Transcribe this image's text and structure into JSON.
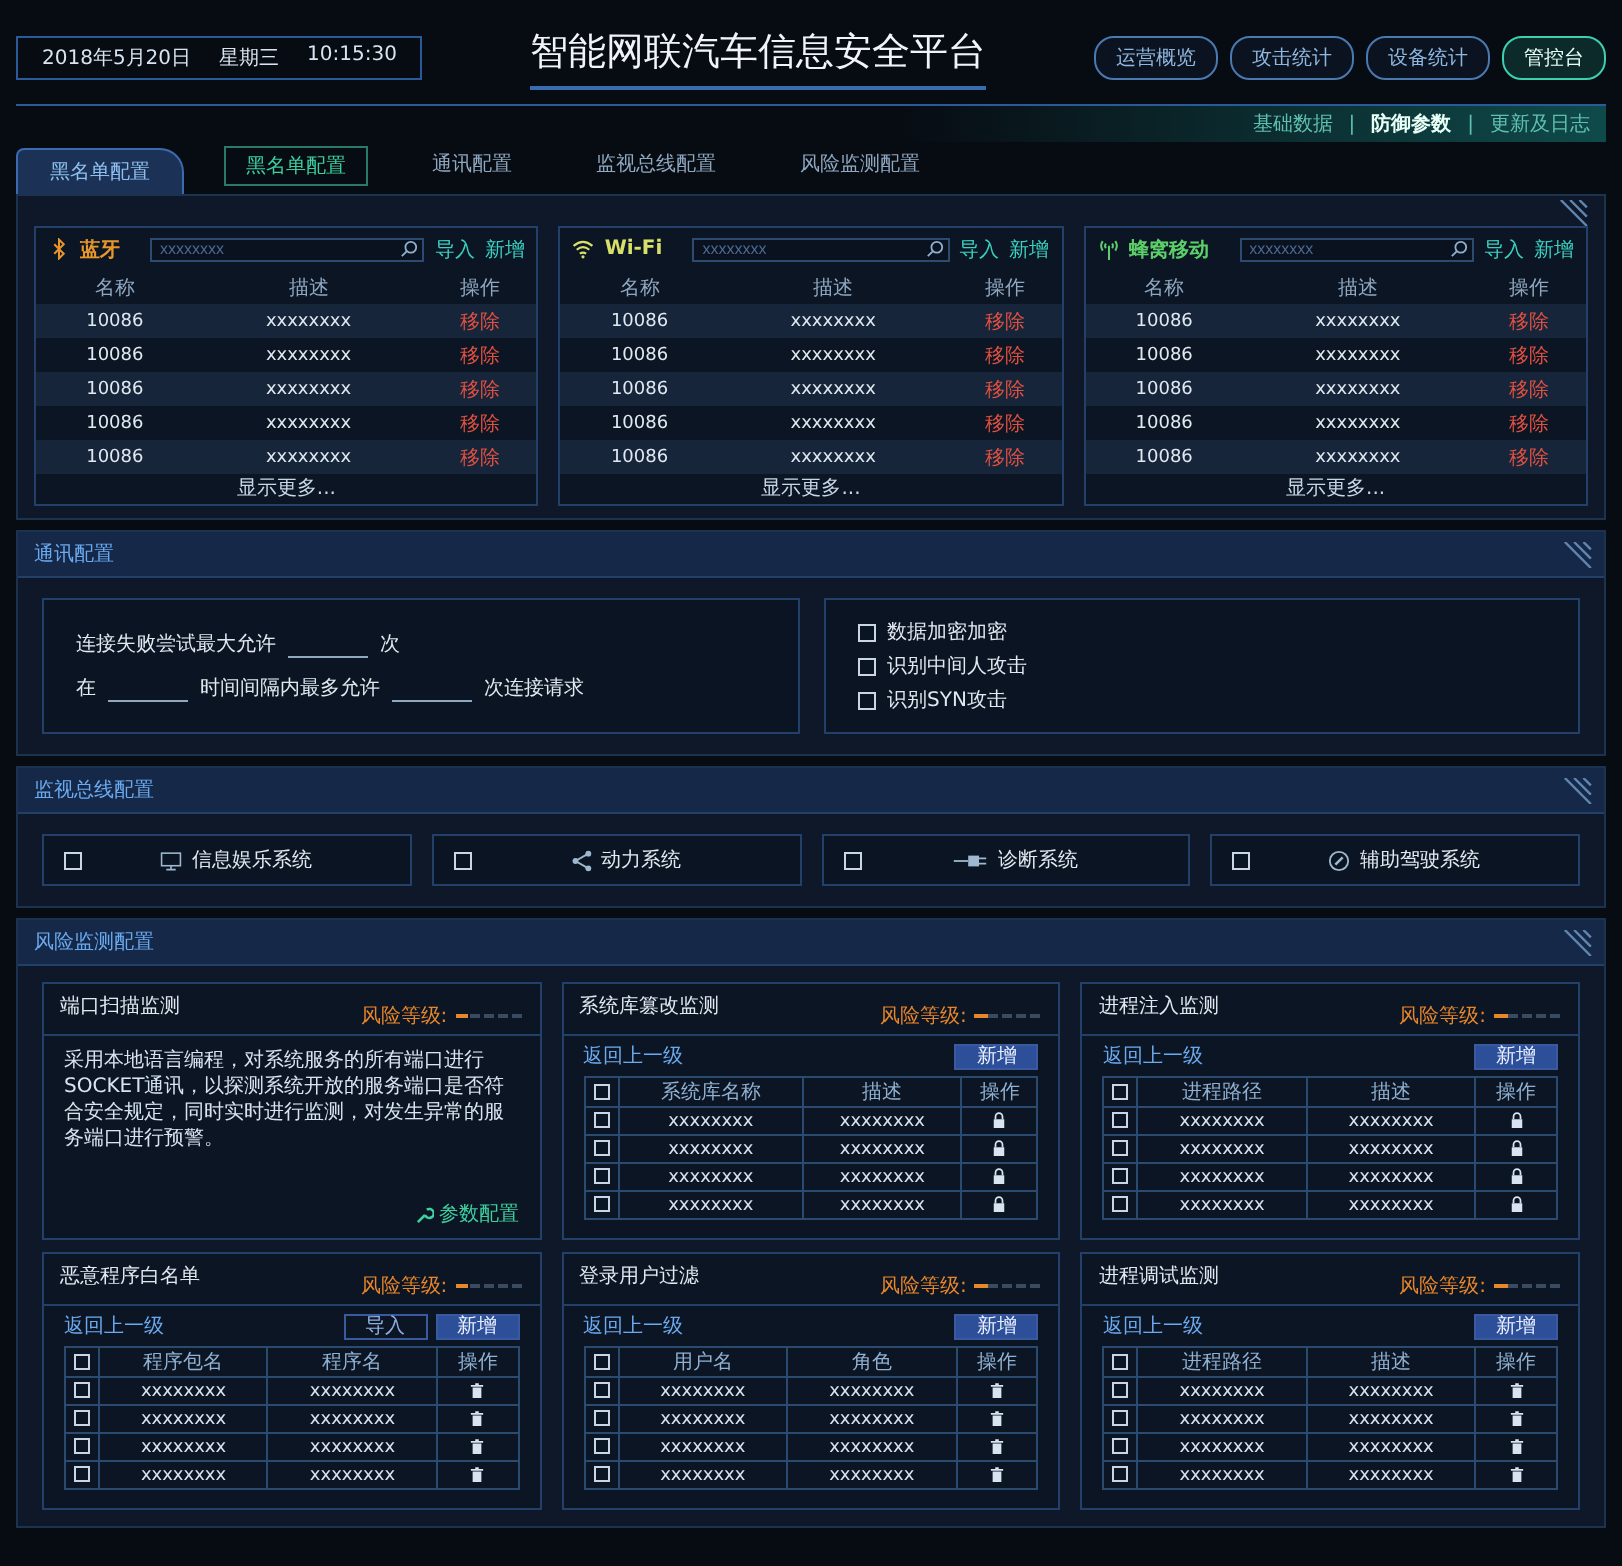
{
  "header": {
    "date": "2018年5月20日",
    "weekday": "星期三",
    "time": "10:15:30",
    "title": "智能网联汽车信息安全平台"
  },
  "nav": [
    {
      "label": "运营概览",
      "selected": false
    },
    {
      "label": "攻击统计",
      "selected": false
    },
    {
      "label": "设备统计",
      "selected": false
    },
    {
      "label": "管控台",
      "selected": true
    }
  ],
  "subnav": [
    {
      "kind": "link",
      "label": "基础数据",
      "selected": false
    },
    {
      "kind": "separator",
      "label": "|"
    },
    {
      "kind": "link",
      "label": "防御参数",
      "selected": true
    },
    {
      "kind": "separator",
      "label": "|"
    },
    {
      "kind": "link",
      "label": "更新及日志",
      "selected": false
    }
  ],
  "side_tab": {
    "label": "黑名单配置"
  },
  "tabs": [
    {
      "label": "黑名单配置",
      "selected": true
    },
    {
      "label": "通讯配置",
      "selected": false
    },
    {
      "label": "监视总线配置",
      "selected": false
    },
    {
      "label": "风险监测配置",
      "selected": false
    }
  ],
  "blacklist": {
    "lists": [
      {
        "kind": "bluetooth",
        "title": "蓝牙",
        "placeholder": "xxxxxxxx",
        "actions": [
          "导入",
          "新增"
        ],
        "columns": [
          "名称",
          "描述",
          "操作"
        ],
        "rows": [
          [
            "10086",
            "xxxxxxxx",
            "移除"
          ],
          [
            "10086",
            "xxxxxxxx",
            "移除"
          ],
          [
            "10086",
            "xxxxxxxx",
            "移除"
          ],
          [
            "10086",
            "xxxxxxxx",
            "移除"
          ],
          [
            "10086",
            "xxxxxxxx",
            "移除"
          ]
        ],
        "more": "显示更多..."
      },
      {
        "kind": "wifi",
        "title": "Wi-Fi",
        "placeholder": "xxxxxxxx",
        "actions": [
          "导入",
          "新增"
        ],
        "columns": [
          "名称",
          "描述",
          "操作"
        ],
        "rows": [
          [
            "10086",
            "xxxxxxxx",
            "移除"
          ],
          [
            "10086",
            "xxxxxxxx",
            "移除"
          ],
          [
            "10086",
            "xxxxxxxx",
            "移除"
          ],
          [
            "10086",
            "xxxxxxxx",
            "移除"
          ],
          [
            "10086",
            "xxxxxxxx",
            "移除"
          ]
        ],
        "more": "显示更多..."
      },
      {
        "kind": "cellular",
        "title": "蜂窝移动",
        "placeholder": "xxxxxxxx",
        "actions": [
          "导入",
          "新增"
        ],
        "columns": [
          "名称",
          "描述",
          "操作"
        ],
        "rows": [
          [
            "10086",
            "xxxxxxxx",
            "移除"
          ],
          [
            "10086",
            "xxxxxxxx",
            "移除"
          ],
          [
            "10086",
            "xxxxxxxx",
            "移除"
          ],
          [
            "10086",
            "xxxxxxxx",
            "移除"
          ],
          [
            "10086",
            "xxxxxxxx",
            "移除"
          ]
        ],
        "more": "显示更多..."
      }
    ]
  },
  "comm": {
    "title": "通讯配置",
    "lines": [
      [
        {
          "kind": "text",
          "text": "连接失败尝试最大允许"
        },
        {
          "kind": "field"
        },
        {
          "kind": "text",
          "text": "次"
        }
      ],
      [
        {
          "kind": "text",
          "text": "在"
        },
        {
          "kind": "field"
        },
        {
          "kind": "text",
          "text": "时间间隔内最多允许"
        },
        {
          "kind": "field"
        },
        {
          "kind": "text",
          "text": "次连接请求"
        }
      ]
    ],
    "options": [
      {
        "label": "数据加密加密",
        "checked": false
      },
      {
        "label": "识别中间人攻击",
        "checked": false
      },
      {
        "label": "识别SYN攻击",
        "checked": false
      }
    ]
  },
  "bus": {
    "title": "监视总线配置",
    "systems": [
      {
        "kind": "display",
        "label": "信息娱乐系统",
        "checked": false
      },
      {
        "kind": "share",
        "label": "动力系统",
        "checked": false
      },
      {
        "kind": "plug",
        "label": "诊断系统",
        "checked": false
      },
      {
        "kind": "gauge",
        "label": "辅助驾驶系统",
        "checked": false
      }
    ]
  },
  "risk": {
    "title": "风险监测配置",
    "cards": [
      {
        "kind": "text",
        "title": "端口扫描监测",
        "risk_label": "风险等级:",
        "level": 0.2,
        "body": "采用本地语言编程，对系统服务的所有端口进行SOCKET通讯，以探测系统开放的服务端口是否符合安全规定，同时实时进行监测，对发生异常的服务端口进行预警。",
        "link": "参数配置"
      },
      {
        "kind": "table",
        "title": "系统库篡改监测",
        "risk_label": "风险等级:",
        "level": 0.2,
        "back": "返回上一级",
        "buttons": [
          {
            "kind": "primary",
            "label": "新增"
          }
        ],
        "columns": [
          "系统库名称",
          "描述",
          "操作"
        ],
        "select_all": {
          "checked": false
        },
        "rows": [
          {
            "kind": "lock",
            "cells": [
              "xxxxxxxx",
              "xxxxxxxx"
            ],
            "checked": false
          },
          {
            "kind": "lock",
            "cells": [
              "xxxxxxxx",
              "xxxxxxxx"
            ],
            "checked": false
          },
          {
            "kind": "lock",
            "cells": [
              "xxxxxxxx",
              "xxxxxxxx"
            ],
            "checked": false
          },
          {
            "kind": "lock",
            "cells": [
              "xxxxxxxx",
              "xxxxxxxx"
            ],
            "checked": false
          }
        ]
      },
      {
        "kind": "table",
        "title": "进程注入监测",
        "risk_label": "风险等级:",
        "level": 0.2,
        "back": "返回上一级",
        "buttons": [
          {
            "kind": "primary",
            "label": "新增"
          }
        ],
        "columns": [
          "进程路径",
          "描述",
          "操作"
        ],
        "select_all": {
          "checked": false
        },
        "rows": [
          {
            "kind": "lock",
            "cells": [
              "xxxxxxxx",
              "xxxxxxxx"
            ],
            "checked": false
          },
          {
            "kind": "lock",
            "cells": [
              "xxxxxxxx",
              "xxxxxxxx"
            ],
            "checked": false
          },
          {
            "kind": "lock",
            "cells": [
              "xxxxxxxx",
              "xxxxxxxx"
            ],
            "checked": false
          },
          {
            "kind": "lock",
            "cells": [
              "xxxxxxxx",
              "xxxxxxxx"
            ],
            "checked": false
          }
        ]
      },
      {
        "kind": "table",
        "title": "恶意程序白名单",
        "risk_label": "风险等级:",
        "level": 0.2,
        "back": "返回上一级",
        "buttons": [
          {
            "kind": "outline",
            "label": "导入"
          },
          {
            "kind": "primary",
            "label": "新增"
          }
        ],
        "columns": [
          "程序包名",
          "程序名",
          "操作"
        ],
        "select_all": {
          "checked": false
        },
        "rows": [
          {
            "kind": "trash",
            "cells": [
              "xxxxxxxx",
              "xxxxxxxx"
            ],
            "checked": false
          },
          {
            "kind": "trash",
            "cells": [
              "xxxxxxxx",
              "xxxxxxxx"
            ],
            "checked": false
          },
          {
            "kind": "trash",
            "cells": [
              "xxxxxxxx",
              "xxxxxxxx"
            ],
            "checked": false
          },
          {
            "kind": "trash",
            "cells": [
              "xxxxxxxx",
              "xxxxxxxx"
            ],
            "checked": false
          }
        ]
      },
      {
        "kind": "table",
        "title": "登录用户过滤",
        "risk_label": "风险等级:",
        "level": 0.2,
        "back": "返回上一级",
        "buttons": [
          {
            "kind": "primary",
            "label": "新增"
          }
        ],
        "columns": [
          "用户名",
          "角色",
          "操作"
        ],
        "select_all": {
          "checked": false
        },
        "rows": [
          {
            "kind": "trash",
            "cells": [
              "xxxxxxxx",
              "xxxxxxxx"
            ],
            "checked": false
          },
          {
            "kind": "trash",
            "cells": [
              "xxxxxxxx",
              "xxxxxxxx"
            ],
            "checked": false
          },
          {
            "kind": "trash",
            "cells": [
              "xxxxxxxx",
              "xxxxxxxx"
            ],
            "checked": false
          },
          {
            "kind": "trash",
            "cells": [
              "xxxxxxxx",
              "xxxxxxxx"
            ],
            "checked": false
          }
        ]
      },
      {
        "kind": "table",
        "title": "进程调试监测",
        "risk_label": "风险等级:",
        "level": 0.2,
        "back": "返回上一级",
        "buttons": [
          {
            "kind": "primary",
            "label": "新增"
          }
        ],
        "columns": [
          "进程路径",
          "描述",
          "操作"
        ],
        "select_all": {
          "checked": false
        },
        "rows": [
          {
            "kind": "trash",
            "cells": [
              "xxxxxxxx",
              "xxxxxxxx"
            ],
            "checked": false
          },
          {
            "kind": "trash",
            "cells": [
              "xxxxxxxx",
              "xxxxxxxx"
            ],
            "checked": false
          },
          {
            "kind": "trash",
            "cells": [
              "xxxxxxxx",
              "xxxxxxxx"
            ],
            "checked": false
          },
          {
            "kind": "trash",
            "cells": [
              "xxxxxxxx",
              "xxxxxxxx"
            ],
            "checked": false
          }
        ]
      }
    ]
  }
}
